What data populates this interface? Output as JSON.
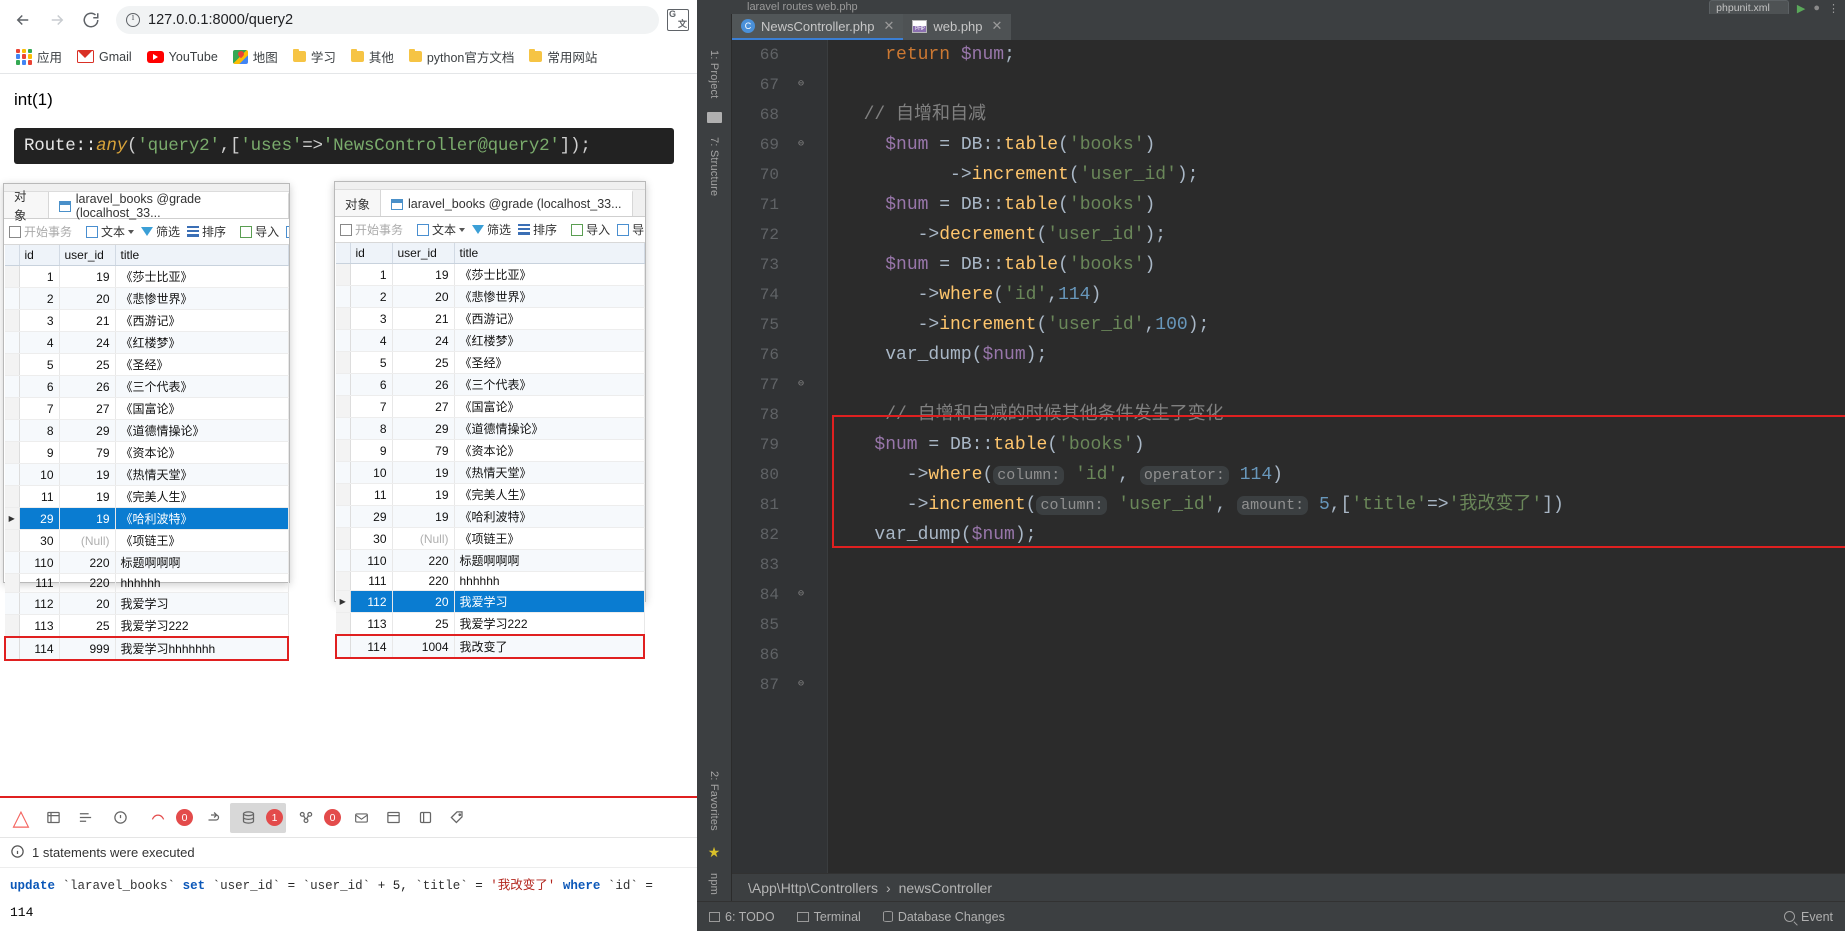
{
  "browser": {
    "url": "127.0.0.1:8000/query2",
    "nav": {
      "back": "back-arrow",
      "forward": "forward-arrow",
      "reload": "reload"
    },
    "bookmarks": [
      {
        "label": "应用",
        "icon": "apps-grid-icon"
      },
      {
        "label": "Gmail",
        "icon": "gmail-icon"
      },
      {
        "label": "YouTube",
        "icon": "youtube-icon"
      },
      {
        "label": "地图",
        "icon": "google-maps-icon"
      },
      {
        "label": "学习",
        "icon": "folder-icon"
      },
      {
        "label": "其他",
        "icon": "folder-icon"
      },
      {
        "label": "python官方文档",
        "icon": "folder-icon"
      },
      {
        "label": "常用网站",
        "icon": "folder-icon"
      }
    ]
  },
  "page": {
    "var_dump_output": "int(1)",
    "route_code": {
      "prefix": "Route::",
      "method": "any",
      "open": "(",
      "arg1": "'query2'",
      "comma": ",[",
      "key": "'uses'",
      "arrow": "=>",
      "value": "'NewsController@query2'",
      "close": "]);"
    }
  },
  "navicat": {
    "tab_object": "对象",
    "tab_table": "laravel_books @grade (localhost_33...",
    "toolbar": [
      "开始事务",
      "文本",
      "筛选",
      "排序",
      "导入",
      "导出"
    ],
    "columns": [
      "id",
      "user_id",
      "title"
    ],
    "rows_left": [
      {
        "id": "1",
        "user_id": "19",
        "title": "《莎士比亚》"
      },
      {
        "id": "2",
        "user_id": "20",
        "title": "《悲惨世界》"
      },
      {
        "id": "3",
        "user_id": "21",
        "title": "《西游记》"
      },
      {
        "id": "4",
        "user_id": "24",
        "title": "《红楼梦》"
      },
      {
        "id": "5",
        "user_id": "25",
        "title": "《圣经》"
      },
      {
        "id": "6",
        "user_id": "26",
        "title": "《三个代表》"
      },
      {
        "id": "7",
        "user_id": "27",
        "title": "《国富论》"
      },
      {
        "id": "8",
        "user_id": "29",
        "title": "《道德情操论》"
      },
      {
        "id": "9",
        "user_id": "79",
        "title": "《资本论》"
      },
      {
        "id": "10",
        "user_id": "19",
        "title": "《热情天堂》"
      },
      {
        "id": "11",
        "user_id": "19",
        "title": "《完美人生》"
      },
      {
        "id": "29",
        "user_id": "19",
        "title": "《哈利波特》",
        "selected": true
      },
      {
        "id": "30",
        "user_id": "(Null)",
        "title": "《项链王》",
        "null": true
      },
      {
        "id": "110",
        "user_id": "220",
        "title": "标题啊啊啊"
      },
      {
        "id": "111",
        "user_id": "220",
        "title": "hhhhhh"
      },
      {
        "id": "112",
        "user_id": "20",
        "title": "我爱学习"
      },
      {
        "id": "113",
        "user_id": "25",
        "title": "我爱学习222"
      },
      {
        "id": "114",
        "user_id": "999",
        "title": "我爱学习hhhhhhh",
        "highlight": true
      }
    ],
    "rows_right": [
      {
        "id": "1",
        "user_id": "19",
        "title": "《莎士比亚》"
      },
      {
        "id": "2",
        "user_id": "20",
        "title": "《悲惨世界》"
      },
      {
        "id": "3",
        "user_id": "21",
        "title": "《西游记》"
      },
      {
        "id": "4",
        "user_id": "24",
        "title": "《红楼梦》"
      },
      {
        "id": "5",
        "user_id": "25",
        "title": "《圣经》"
      },
      {
        "id": "6",
        "user_id": "26",
        "title": "《三个代表》"
      },
      {
        "id": "7",
        "user_id": "27",
        "title": "《国富论》"
      },
      {
        "id": "8",
        "user_id": "29",
        "title": "《道德情操论》"
      },
      {
        "id": "9",
        "user_id": "79",
        "title": "《资本论》"
      },
      {
        "id": "10",
        "user_id": "19",
        "title": "《热情天堂》"
      },
      {
        "id": "11",
        "user_id": "19",
        "title": "《完美人生》"
      },
      {
        "id": "29",
        "user_id": "19",
        "title": "《哈利波特》"
      },
      {
        "id": "30",
        "user_id": "(Null)",
        "title": "《项链王》",
        "null": true
      },
      {
        "id": "110",
        "user_id": "220",
        "title": "标题啊啊啊"
      },
      {
        "id": "111",
        "user_id": "220",
        "title": "hhhhhh"
      },
      {
        "id": "112",
        "user_id": "20",
        "title": "我爱学习",
        "selected": true
      },
      {
        "id": "113",
        "user_id": "25",
        "title": "我爱学习222"
      },
      {
        "id": "114",
        "user_id": "1004",
        "title": "我改变了",
        "highlight": true
      }
    ]
  },
  "debugbar": {
    "badges": {
      "exceptions": "0",
      "queries": "1",
      "models": "0"
    },
    "status_text": "1 statements were executed",
    "sql": {
      "update": "update",
      "table": "`laravel_books`",
      "set": "set",
      "col1": "`user_id`",
      "eq1": "=",
      "col1b": "`user_id`",
      "plus": "+ 5,",
      "col2": "`title`",
      "eq2": "=",
      "val2": "'我改变了'",
      "where": "where",
      "col3": "`id`",
      "eq3": "="
    },
    "sql_value": "114"
  },
  "ide": {
    "top_breadcrumb": "laravel  routes  web.php",
    "pill_label": "phpunit.xml",
    "tabs": [
      {
        "label": "NewsController.php",
        "icon": "class-icon",
        "active": true
      },
      {
        "label": "web.php",
        "icon": "php-file-icon",
        "active": false
      }
    ],
    "rail_left": [
      "1: Project",
      "7: Structure"
    ],
    "rail_bottom": [
      "2: Favorites",
      "npm"
    ],
    "breadcrumb": {
      "path": "\\App\\Http\\Controllers",
      "sep": "›",
      "leaf": "newsController"
    },
    "statusbar": {
      "todo": "6: TODO",
      "terminal": "Terminal",
      "db_changes": "Database Changes",
      "event_log": "Event"
    },
    "code_lines": [
      {
        "n": "66",
        "fold": true,
        "tokens": [
          {
            "t": "plain",
            "v": "    "
          },
          {
            "t": "kw",
            "v": "return"
          },
          {
            "t": "plain",
            "v": " "
          },
          {
            "t": "var",
            "v": "$num"
          },
          {
            "t": "plain",
            "v": ";"
          }
        ]
      },
      {
        "n": "67",
        "fold": false,
        "tokens": []
      },
      {
        "n": "68",
        "fold": true,
        "tokens": [
          {
            "t": "com",
            "v": "  // 自增和自减"
          }
        ]
      },
      {
        "n": "69",
        "fold": false,
        "tokens": [
          {
            "t": "plain",
            "v": "    "
          },
          {
            "t": "var",
            "v": "$num"
          },
          {
            "t": "plain",
            "v": " = "
          },
          {
            "t": "cls",
            "v": "DB"
          },
          {
            "t": "plain",
            "v": "::"
          },
          {
            "t": "fn",
            "v": "table"
          },
          {
            "t": "plain",
            "v": "("
          },
          {
            "t": "str",
            "v": "'books'"
          },
          {
            "t": "plain",
            "v": ")"
          }
        ]
      },
      {
        "n": "70",
        "fold": false,
        "tokens": [
          {
            "t": "plain",
            "v": "          ->"
          },
          {
            "t": "fn",
            "v": "increment"
          },
          {
            "t": "plain",
            "v": "("
          },
          {
            "t": "str",
            "v": "'user_id'"
          },
          {
            "t": "plain",
            "v": ");"
          }
        ]
      },
      {
        "n": "71",
        "fold": false,
        "tokens": [
          {
            "t": "plain",
            "v": "    "
          },
          {
            "t": "var",
            "v": "$num"
          },
          {
            "t": "plain",
            "v": " = "
          },
          {
            "t": "cls",
            "v": "DB"
          },
          {
            "t": "plain",
            "v": "::"
          },
          {
            "t": "fn",
            "v": "table"
          },
          {
            "t": "plain",
            "v": "("
          },
          {
            "t": "str",
            "v": "'books'"
          },
          {
            "t": "plain",
            "v": ")"
          }
        ]
      },
      {
        "n": "72",
        "fold": false,
        "tokens": [
          {
            "t": "plain",
            "v": "       ->"
          },
          {
            "t": "fn",
            "v": "decrement"
          },
          {
            "t": "plain",
            "v": "("
          },
          {
            "t": "str",
            "v": "'user_id'"
          },
          {
            "t": "plain",
            "v": ");"
          }
        ]
      },
      {
        "n": "73",
        "fold": false,
        "tokens": [
          {
            "t": "plain",
            "v": "    "
          },
          {
            "t": "var",
            "v": "$num"
          },
          {
            "t": "plain",
            "v": " = "
          },
          {
            "t": "cls",
            "v": "DB"
          },
          {
            "t": "plain",
            "v": "::"
          },
          {
            "t": "fn",
            "v": "table"
          },
          {
            "t": "plain",
            "v": "("
          },
          {
            "t": "str",
            "v": "'books'"
          },
          {
            "t": "plain",
            "v": ")"
          }
        ]
      },
      {
        "n": "74",
        "fold": false,
        "tokens": [
          {
            "t": "plain",
            "v": "       ->"
          },
          {
            "t": "fn",
            "v": "where"
          },
          {
            "t": "plain",
            "v": "("
          },
          {
            "t": "str",
            "v": "'id'"
          },
          {
            "t": "plain",
            "v": ","
          },
          {
            "t": "num",
            "v": "114"
          },
          {
            "t": "plain",
            "v": ")"
          }
        ]
      },
      {
        "n": "75",
        "fold": false,
        "tokens": [
          {
            "t": "plain",
            "v": "       ->"
          },
          {
            "t": "fn",
            "v": "increment"
          },
          {
            "t": "plain",
            "v": "("
          },
          {
            "t": "str",
            "v": "'user_id'"
          },
          {
            "t": "plain",
            "v": ","
          },
          {
            "t": "num",
            "v": "100"
          },
          {
            "t": "plain",
            "v": ");"
          }
        ]
      },
      {
        "n": "76",
        "fold": true,
        "tokens": [
          {
            "t": "plain",
            "v": "    "
          },
          {
            "t": "fn2",
            "v": "var_dump"
          },
          {
            "t": "plain",
            "v": "("
          },
          {
            "t": "var",
            "v": "$num"
          },
          {
            "t": "plain",
            "v": ");"
          }
        ]
      },
      {
        "n": "77",
        "fold": false,
        "tokens": []
      },
      {
        "n": "78",
        "fold": false,
        "tokens": [
          {
            "t": "com",
            "v": "    // 自增和自减的时候其他条件发生了变化"
          }
        ]
      },
      {
        "n": "79",
        "fold": false,
        "tokens": [
          {
            "t": "plain",
            "v": "   "
          },
          {
            "t": "var",
            "v": "$num"
          },
          {
            "t": "plain",
            "v": " = "
          },
          {
            "t": "cls",
            "v": "DB"
          },
          {
            "t": "plain",
            "v": "::"
          },
          {
            "t": "fn",
            "v": "table"
          },
          {
            "t": "plain",
            "v": "("
          },
          {
            "t": "str",
            "v": "'books'"
          },
          {
            "t": "plain",
            "v": ")"
          }
        ]
      },
      {
        "n": "80",
        "fold": false,
        "tokens": [
          {
            "t": "plain",
            "v": "      ->"
          },
          {
            "t": "fn",
            "v": "where"
          },
          {
            "t": "plain",
            "v": "("
          },
          {
            "t": "hint",
            "v": "column:"
          },
          {
            "t": "plain",
            "v": " "
          },
          {
            "t": "str",
            "v": "'id'"
          },
          {
            "t": "plain",
            "v": ", "
          },
          {
            "t": "hint",
            "v": "operator:"
          },
          {
            "t": "plain",
            "v": " "
          },
          {
            "t": "num",
            "v": "114"
          },
          {
            "t": "plain",
            "v": ")"
          }
        ]
      },
      {
        "n": "81",
        "fold": false,
        "tokens": [
          {
            "t": "plain",
            "v": "      ->"
          },
          {
            "t": "fn",
            "v": "increment"
          },
          {
            "t": "plain",
            "v": "("
          },
          {
            "t": "hint",
            "v": "column:"
          },
          {
            "t": "plain",
            "v": " "
          },
          {
            "t": "str",
            "v": "'user_id'"
          },
          {
            "t": "plain",
            "v": ", "
          },
          {
            "t": "hint",
            "v": "amount:"
          },
          {
            "t": "plain",
            "v": " "
          },
          {
            "t": "num",
            "v": "5"
          },
          {
            "t": "plain",
            "v": ",["
          },
          {
            "t": "str",
            "v": "'title'"
          },
          {
            "t": "plain",
            "v": "=>"
          },
          {
            "t": "str",
            "v": "'我改变了'"
          },
          {
            "t": "plain",
            "v": "])"
          }
        ]
      },
      {
        "n": "82",
        "fold": false,
        "tokens": [
          {
            "t": "plain",
            "v": "   "
          },
          {
            "t": "fn2",
            "v": "var_dump"
          },
          {
            "t": "plain",
            "v": "("
          },
          {
            "t": "var",
            "v": "$num"
          },
          {
            "t": "plain",
            "v": ");"
          }
        ]
      },
      {
        "n": "83",
        "fold": true,
        "tokens": []
      },
      {
        "n": "84",
        "fold": false,
        "tokens": []
      },
      {
        "n": "85",
        "fold": false,
        "tokens": []
      },
      {
        "n": "86",
        "fold": true,
        "tokens": []
      },
      {
        "n": "87",
        "fold": false,
        "tokens": []
      }
    ]
  }
}
